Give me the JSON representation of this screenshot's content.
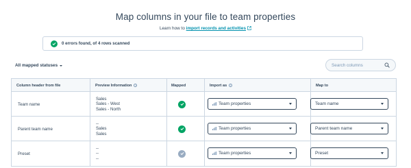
{
  "header": {
    "title": "Map columns in your file to team properties",
    "learn_prefix": "Learn how to",
    "learn_link": "import records and activities"
  },
  "banner": {
    "text": "0 errors found, of 4 rows scanned",
    "status_color": "#00a464"
  },
  "filter": {
    "label": "All mapped statuses"
  },
  "search": {
    "placeholder": "Search columns"
  },
  "table": {
    "columns": {
      "column_header": "Column header from file",
      "preview": "Preview Information",
      "mapped": "Mapped",
      "import_as": "Import as",
      "map_to": "Map to"
    },
    "rows": [
      {
        "header": "Team name",
        "preview": [
          "Sales",
          "Sales - West",
          "Sales - North"
        ],
        "mapped_icon": "check-circle-icon",
        "import_as": "Team properties",
        "map_to": "Team name"
      },
      {
        "header": "Parent team name",
        "preview": [
          "--",
          "Sales",
          "Sales"
        ],
        "mapped_icon": "check-circle-icon",
        "import_as": "Team properties",
        "map_to": "Parent team name"
      },
      {
        "header": "Preset",
        "preview": [
          "--",
          "--",
          "--"
        ],
        "mapped_icon": "check-circle-muted-icon",
        "import_as": "Team properties",
        "map_to": "Preset"
      }
    ]
  },
  "colors": {
    "text": "#33475b",
    "link": "#0091ae",
    "border": "#cbd6e2",
    "success": "#00a464",
    "muted": "#99acc2"
  }
}
